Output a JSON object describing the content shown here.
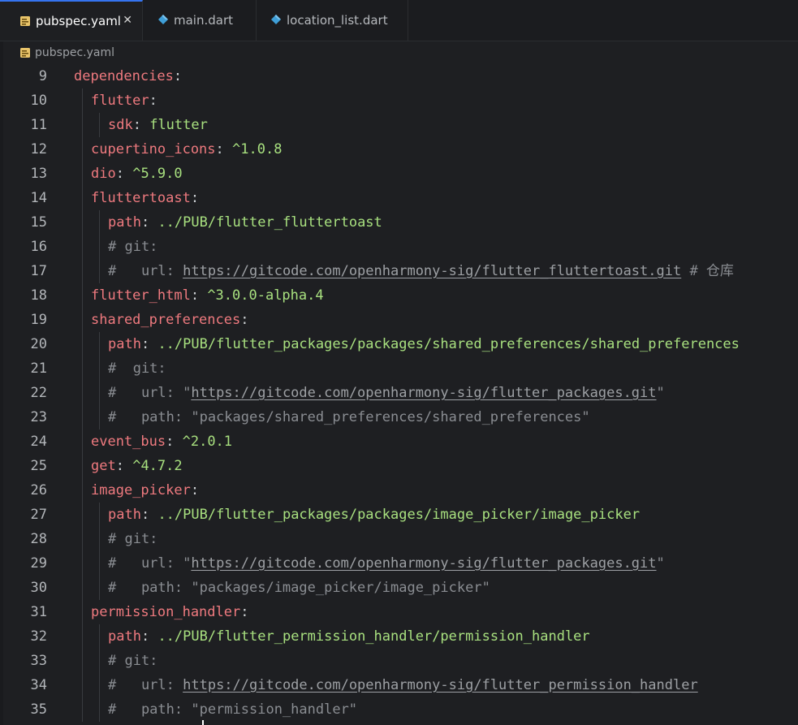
{
  "tabs": [
    {
      "label": "pubspec.yaml",
      "icon": "yaml-file-icon",
      "active": true,
      "close": "✕"
    },
    {
      "label": "main.dart",
      "icon": "dart-file-icon",
      "active": false
    },
    {
      "label": "location_list.dart",
      "icon": "dart-file-icon",
      "active": false
    }
  ],
  "breadcrumb": {
    "label": "pubspec.yaml",
    "icon": "yaml-file-icon"
  },
  "lines": [
    {
      "n": "9",
      "indent": 0,
      "key": "dependencies",
      "sep": ":"
    },
    {
      "n": "10",
      "indent": 1,
      "key": "flutter",
      "sep": ":"
    },
    {
      "n": "11",
      "indent": 2,
      "key": "sdk",
      "sep": ": ",
      "val": "flutter"
    },
    {
      "n": "12",
      "indent": 1,
      "key": "cupertino_icons",
      "sep": ": ",
      "val": "^1.0.8"
    },
    {
      "n": "13",
      "indent": 1,
      "key": "dio",
      "sep": ": ",
      "val": "^5.9.0"
    },
    {
      "n": "14",
      "indent": 1,
      "key": "fluttertoast",
      "sep": ":"
    },
    {
      "n": "15",
      "indent": 2,
      "key": "path",
      "sep": ": ",
      "val": "../PUB/flutter_fluttertoast"
    },
    {
      "n": "16",
      "indent": 2,
      "c1": "# git:"
    },
    {
      "n": "17",
      "indent": 2,
      "c1": "#   url: ",
      "url": "https://gitcode.com/openharmony-sig/flutter_fluttertoast.git",
      "c2": " # 仓库"
    },
    {
      "n": "18",
      "indent": 1,
      "key": "flutter_html",
      "sep": ": ",
      "val": "^3.0.0-alpha.4"
    },
    {
      "n": "19",
      "indent": 1,
      "key": "shared_preferences",
      "sep": ":"
    },
    {
      "n": "20",
      "indent": 2,
      "key": "path",
      "sep": ": ",
      "val": "../PUB/flutter_packages/packages/shared_preferences/shared_preferences"
    },
    {
      "n": "21",
      "indent": 2,
      "c1": "#  git:"
    },
    {
      "n": "22",
      "indent": 2,
      "c1": "#   url: \"",
      "url": "https://gitcode.com/openharmony-sig/flutter_packages.git",
      "c2": "\""
    },
    {
      "n": "23",
      "indent": 2,
      "c1": "#   path: \"packages/shared_preferences/shared_preferences\""
    },
    {
      "n": "24",
      "indent": 1,
      "key": "event_bus",
      "sep": ": ",
      "val": "^2.0.1"
    },
    {
      "n": "25",
      "indent": 1,
      "key": "get",
      "sep": ": ",
      "val": "^4.7.2"
    },
    {
      "n": "26",
      "indent": 1,
      "key": "image_picker",
      "sep": ":"
    },
    {
      "n": "27",
      "indent": 2,
      "key": "path",
      "sep": ": ",
      "val": "../PUB/flutter_packages/packages/image_picker/image_picker"
    },
    {
      "n": "28",
      "indent": 2,
      "c1": "# git:"
    },
    {
      "n": "29",
      "indent": 2,
      "c1": "#   url: \"",
      "url": "https://gitcode.com/openharmony-sig/flutter_packages.git",
      "c2": "\""
    },
    {
      "n": "30",
      "indent": 2,
      "c1": "#   path: \"packages/image_picker/image_picker\""
    },
    {
      "n": "31",
      "indent": 1,
      "key": "permission_handler",
      "sep": ":"
    },
    {
      "n": "32",
      "indent": 2,
      "key": "path",
      "sep": ": ",
      "val": "../PUB/flutter_permission_handler/permission_handler"
    },
    {
      "n": "33",
      "indent": 2,
      "c1": "# git:"
    },
    {
      "n": "34",
      "indent": 2,
      "c1": "#   url: ",
      "url": "https://gitcode.com/openharmony-sig/flutter_permission_handler"
    },
    {
      "n": "35",
      "indent": 2,
      "c1": "#   path: \"permission_handler\""
    }
  ]
}
